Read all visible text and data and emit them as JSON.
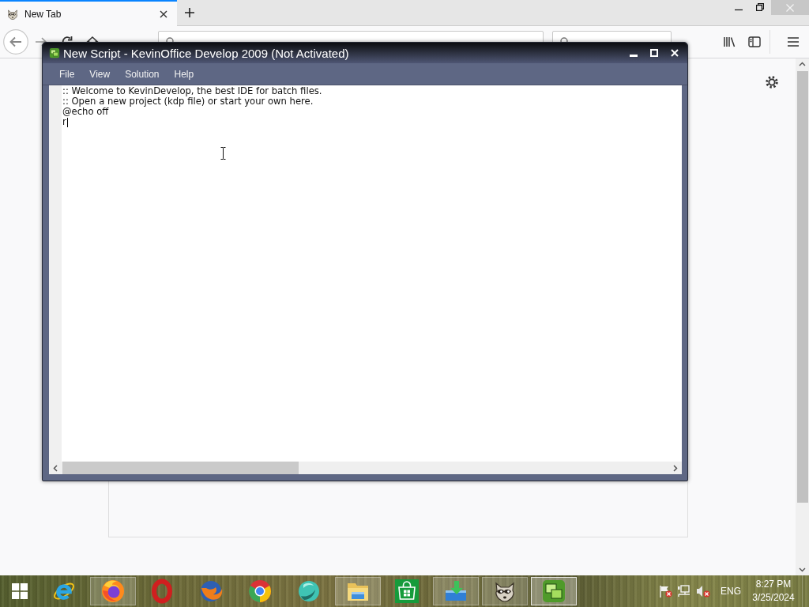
{
  "browser": {
    "tabs": [
      {
        "title": "New Tab",
        "selected": true
      }
    ]
  },
  "app_window": {
    "title": "New Script - KevinOffice Develop 2009 (Not Activated)",
    "menu": [
      "File",
      "View",
      "Solution",
      "Help"
    ],
    "editor": {
      "lines": [
        {
          "text": ":: Welcome to KevinDevelop, the best IDE for batch files.",
          "caret": false
        },
        {
          "text": ":: Open a new project (kdp file) or start your own here.",
          "caret": false
        },
        {
          "text": "@echo off",
          "caret": false
        },
        {
          "text": "r",
          "caret": true
        }
      ]
    }
  },
  "taskbar": {
    "items": [
      {
        "kind": "letter-e",
        "open": false,
        "selected": false
      },
      {
        "kind": "fox",
        "open": true,
        "selected": false
      },
      {
        "kind": "letter-o",
        "open": false,
        "selected": false
      },
      {
        "kind": "fox-classic",
        "open": false,
        "selected": false
      },
      {
        "kind": "ring",
        "open": false,
        "selected": false
      },
      {
        "kind": "globe",
        "open": false,
        "selected": false
      },
      {
        "kind": "folder",
        "open": true,
        "selected": false
      },
      {
        "kind": "bag",
        "open": false,
        "selected": false
      },
      {
        "kind": "download",
        "open": true,
        "selected": false
      },
      {
        "kind": "raccoon",
        "open": true,
        "selected": false
      },
      {
        "kind": "kevin",
        "open": true,
        "selected": true
      }
    ],
    "tray": {
      "language": "ENG",
      "time": "8:27 PM",
      "date": "3/25/2024"
    }
  }
}
